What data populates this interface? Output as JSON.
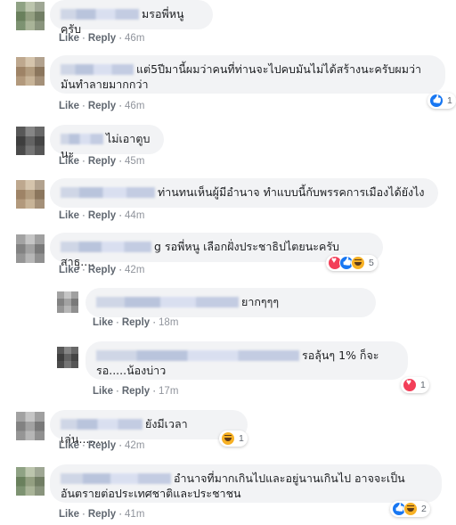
{
  "actions": {
    "like": "Like",
    "reply": "Reply",
    "sep": "·"
  },
  "comments": [
    {
      "text": "มรอพี่หนูครับ",
      "time": "46m"
    },
    {
      "text_line1": "แต่5ปีมานี้ผมว่าคนที่ท่านจะไปคบมันไม่ได้สร้างนะครับผมว่า",
      "text_line2": "มันทำลายมากกว่า",
      "time": "46m",
      "reaction_count": "1",
      "reactions": [
        "like"
      ]
    },
    {
      "text": "ไม่เอาตูบนะ",
      "time": "45m"
    },
    {
      "text": "ท่านทนเห็นผู้มีอำนาจ ทำแบบนี้กับพรรคการเมืองได้ยังไง",
      "time": "44m"
    },
    {
      "text": "g รอพี่หนู เลือกฝั่งประชาธิปไตยนะครับ สาธุ....",
      "time": "42m",
      "reaction_count": "5",
      "reactions": [
        "love",
        "like",
        "haha"
      ]
    },
    {
      "text": "ยากๆๆๆ",
      "time": "18m"
    },
    {
      "text_line1": "รอลุ้นๆ 1% ก็จะ",
      "text_line2": "รอ.....น้องบ่าว",
      "time": "17m",
      "reaction_count": "1",
      "reactions": [
        "love"
      ]
    },
    {
      "text": "ยังมีเวลาเล่น.........",
      "time": "42m",
      "reaction_count": "1",
      "reactions": [
        "haha"
      ]
    },
    {
      "text_line1": "อำนาจที่มากเกินไปและอยู่นานเกินไป อาจจะเป็น",
      "text_line2": "อันตรายต่อประเทศชาติและประชาชน",
      "time": "41m",
      "reaction_count": "2",
      "reactions": [
        "like",
        "haha"
      ]
    }
  ],
  "colors": {
    "bubble": "#f2f3f5",
    "meta": "#606770",
    "like": "#1877f2",
    "love": "#f33e58",
    "haha": "#f7b125"
  }
}
